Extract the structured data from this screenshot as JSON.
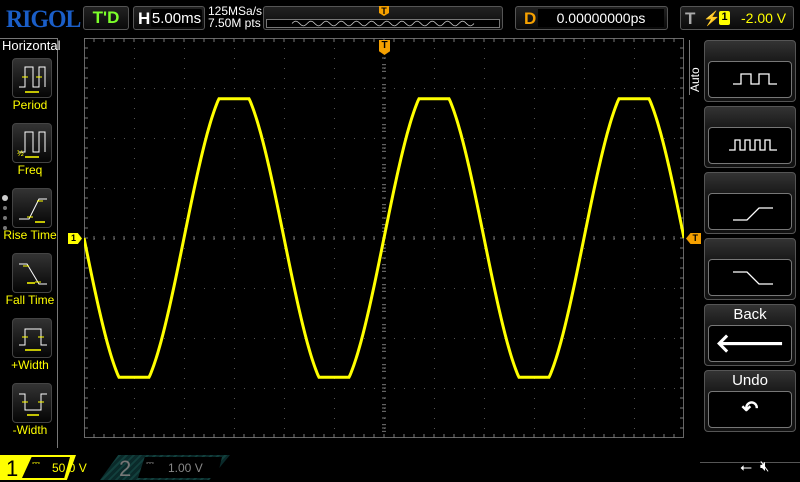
{
  "header": {
    "logo": "RIGOL",
    "run_state": "T'D",
    "horizontal_key": "H",
    "timebase": "5.00ms",
    "sample_rate": "125MSa/s",
    "memory_depth": "7.50M pts",
    "delay_key": "D",
    "delay_value": "0.00000000ps",
    "trigger_key": "T",
    "trigger_source": "1",
    "trigger_level": "-2.00 V"
  },
  "left_menu": {
    "title": "Horizontal",
    "items": [
      {
        "label": "Period"
      },
      {
        "label": "Freq"
      },
      {
        "label": "Rise Time"
      },
      {
        "label": "Fall Time"
      },
      {
        "label": "+Width"
      },
      {
        "label": "-Width"
      }
    ]
  },
  "right_menu": {
    "tab": "Auto",
    "back_label": "Back",
    "undo_label": "Undo"
  },
  "channels": [
    {
      "num": "1",
      "scale": "50.0 V",
      "color": "#ffff00"
    },
    {
      "num": "2",
      "scale": "1.00 V",
      "color": "#1fa39a"
    }
  ],
  "markers": {
    "ch1": "1",
    "trigger": "T"
  },
  "colors": {
    "waveform": "#ffff00",
    "trigger": "#f5a000",
    "logo": "#1a5ec8"
  }
}
